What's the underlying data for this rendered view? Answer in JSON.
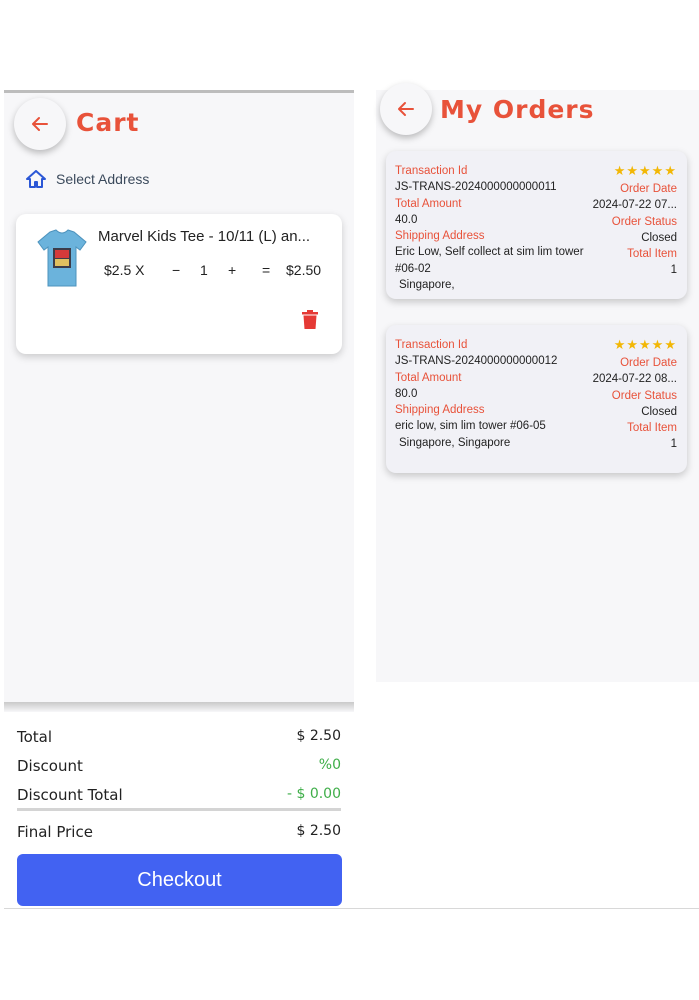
{
  "cart": {
    "title": "Cart",
    "select_address_label": "Select Address",
    "item": {
      "name": "Marvel Kids Tee - 10/11 (L) an...",
      "unit_price": "$2.5 X",
      "minus": "−",
      "quantity": "1",
      "plus": "+",
      "equals": "=",
      "line_total": "$2.50"
    },
    "summary": {
      "total_label": "Total",
      "total_value": "$ 2.50",
      "discount_label": "Discount",
      "discount_value": "%0",
      "discount_total_label": "Discount Total",
      "discount_total_value": "- $ 0.00",
      "final_price_label": "Final Price",
      "final_price_value": "$ 2.50"
    },
    "checkout_label": "Checkout"
  },
  "orders": {
    "title": "My Orders",
    "labels": {
      "transaction_id": "Transaction Id",
      "total_amount": "Total Amount",
      "shipping_address": "Shipping Address",
      "order_date": "Order Date",
      "order_status": "Order Status",
      "total_item": "Total Item"
    },
    "items": [
      {
        "stars": "★★★★★",
        "transaction_id": "JS-TRANS-2024000000000011",
        "total_amount": "40.0",
        "address_line1": "Eric Low, Self collect at sim lim tower #06-02",
        "address_line2": "Singapore,",
        "order_date": "2024-07-22 07...",
        "order_status": "Closed",
        "total_item": "1"
      },
      {
        "stars": "★★★★★",
        "transaction_id": "JS-TRANS-2024000000000012",
        "total_amount": "80.0",
        "address_line1": "eric low, sim lim tower #06-05",
        "address_line2": "Singapore, Singapore",
        "order_date": "2024-07-22 08...",
        "order_status": "Closed",
        "total_item": "1"
      }
    ]
  },
  "colors": {
    "accent": "#e8523a",
    "checkout": "#4262f2",
    "discount_green": "#3fae49",
    "star": "#f2b705"
  },
  "icons": [
    "back-arrow-icon",
    "home-icon",
    "tshirt-image",
    "trash-icon"
  ]
}
